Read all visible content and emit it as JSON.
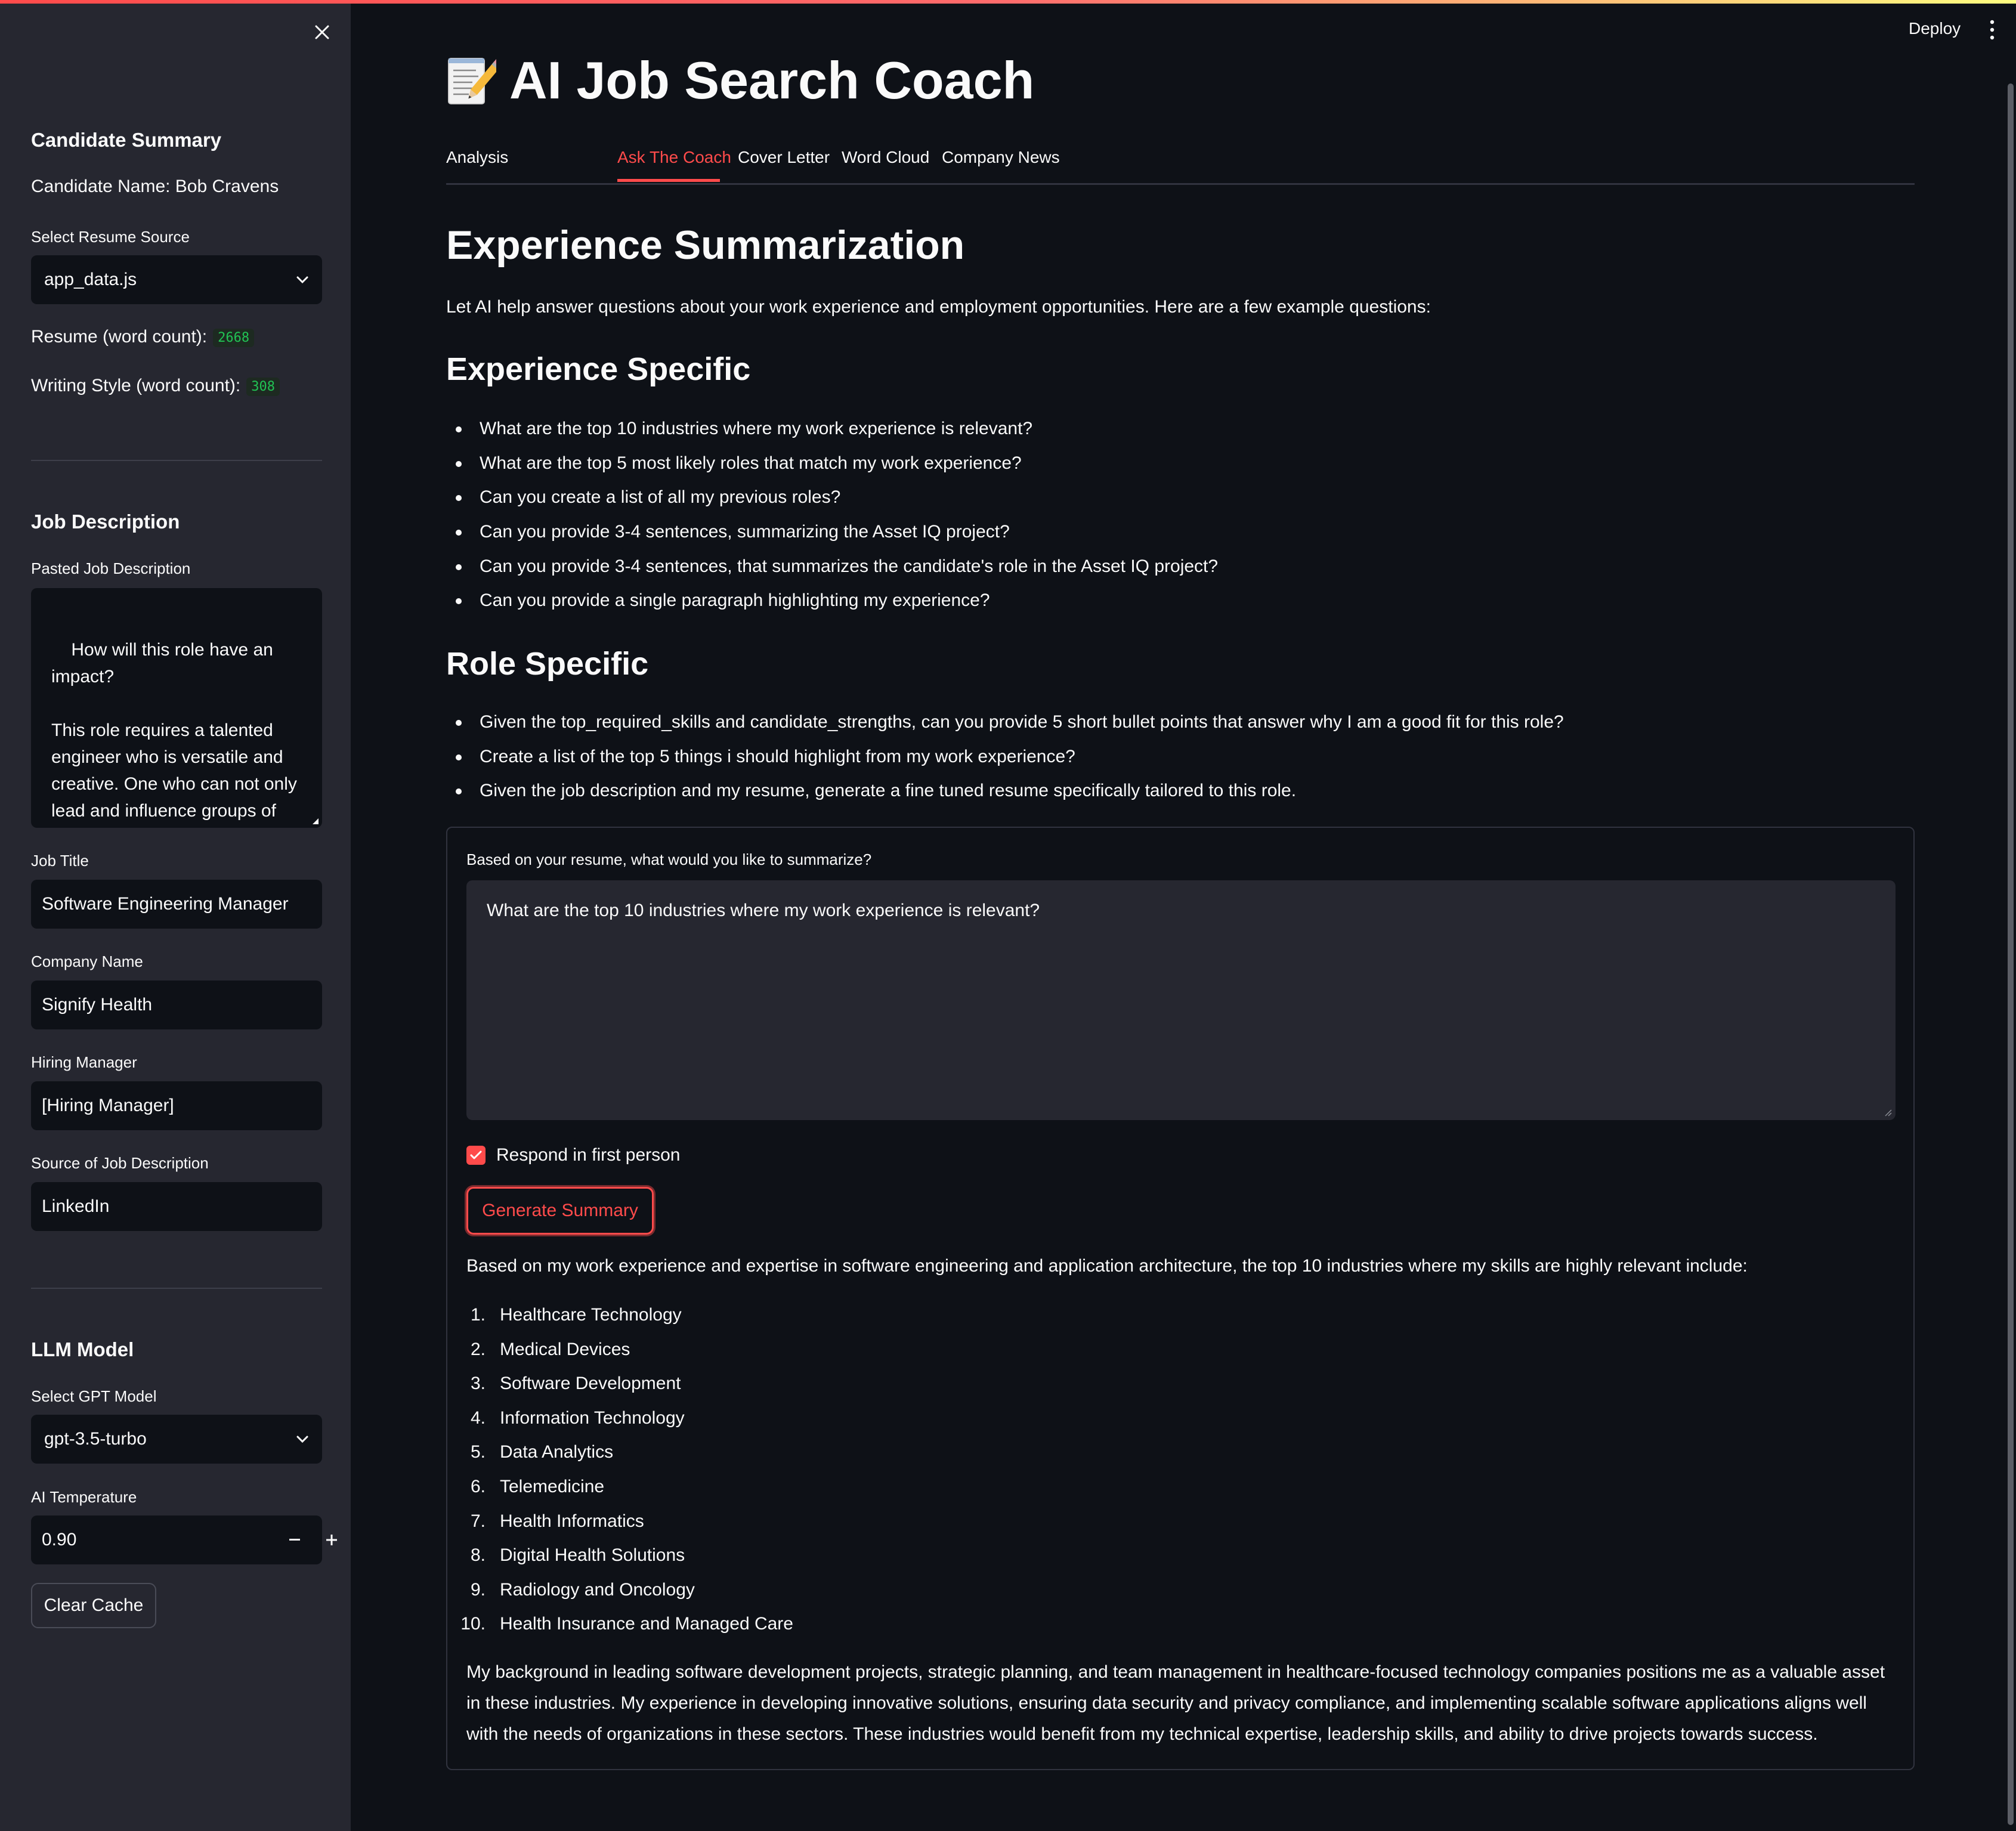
{
  "sidebar": {
    "candidate_summary_heading": "Candidate Summary",
    "candidate_name": "Candidate Name: Bob Cravens",
    "resume_source_label": "Select Resume Source",
    "resume_source_value": "app_data.js",
    "resume_word_count_label": "Resume (word count):",
    "resume_word_count": "2668",
    "writing_style_label": "Writing Style (word count):",
    "writing_style_count": "308",
    "job_description_heading": "Job Description",
    "pasted_jd_label": "Pasted Job Description",
    "pasted_jd_value": "How will this role have an impact?\n\nThis role requires a talented engineer who is versatile and creative. One who can not only lead and influence groups of teams, but be an",
    "job_title_label": "Job Title",
    "job_title_value": "Software Engineering Manager",
    "company_name_label": "Company Name",
    "company_name_value": "Signify Health",
    "hiring_manager_label": "Hiring Manager",
    "hiring_manager_value": "[Hiring Manager]",
    "jd_source_label": "Source of Job Description",
    "jd_source_value": "LinkedIn",
    "llm_heading": "LLM Model",
    "gpt_model_label": "Select GPT Model",
    "gpt_model_value": "gpt-3.5-turbo",
    "temperature_label": "AI Temperature",
    "temperature_value": "0.90",
    "clear_cache_label": "Clear Cache"
  },
  "header": {
    "deploy_label": "Deploy",
    "title": "AI Job Search Coach",
    "title_icon": "memo-icon"
  },
  "tabs": [
    {
      "label": "Analysis"
    },
    {
      "label": "Ask The Coach",
      "active": true
    },
    {
      "label": "Cover Letter"
    },
    {
      "label": "Word Cloud"
    },
    {
      "label": "Company News"
    }
  ],
  "main": {
    "heading": "Experience Summarization",
    "intro": "Let AI help answer questions about your work experience and employment opportunities. Here are a few example questions:",
    "experience_heading": "Experience Specific",
    "experience_questions": [
      "What are the top 10 industries where my work experience is relevant?",
      "What are the top 5 most likely roles that match my work experience?",
      "Can you create a list of all my previous roles?",
      "Can you provide 3-4 sentences, summarizing the Asset IQ project?",
      "Can you provide 3-4 sentences, that summarizes the candidate's role in the Asset IQ project?",
      "Can you provide a single paragraph highlighting my experience?"
    ],
    "role_heading": "Role Specific",
    "role_questions": [
      "Given the top_required_skills and candidate_strengths, can you provide 5 short bullet points that answer why I am a good fit for this role?",
      "Create a list of the top 5 things i should highlight from my work experience?",
      "Given the job description and my resume, generate a fine tuned resume specifically tailored to this role."
    ],
    "form": {
      "prompt_label": "Based on your resume, what would you like to summarize?",
      "prompt_value": "What are the top 10 industries where my work experience is relevant?",
      "first_person_label": "Respond in first person",
      "first_person_checked": true,
      "generate_label": "Generate Summary"
    },
    "result": {
      "intro": "Based on my work experience and expertise in software engineering and application architecture, the top 10 industries where my skills are highly relevant include:",
      "items": [
        {
          "num": "1.",
          "text": "Healthcare Technology"
        },
        {
          "num": "2.",
          "text": "Medical Devices"
        },
        {
          "num": "3.",
          "text": "Software Development"
        },
        {
          "num": "4.",
          "text": "Information Technology"
        },
        {
          "num": "5.",
          "text": "Data Analytics"
        },
        {
          "num": "6.",
          "text": "Telemedicine"
        },
        {
          "num": "7.",
          "text": "Health Informatics"
        },
        {
          "num": "8.",
          "text": "Digital Health Solutions"
        },
        {
          "num": "9.",
          "text": "Radiology and Oncology"
        },
        {
          "num": "10.",
          "text": "Health Insurance and Managed Care"
        }
      ],
      "conclusion": "My background in leading software development projects, strategic planning, and team management in healthcare-focused technology companies positions me as a valuable asset in these industries. My experience in developing innovative solutions, ensuring data security and privacy compliance, and implementing scalable software applications aligns well with the needs of organizations in these sectors. These industries would benefit from my technical expertise, leadership skills, and ability to drive projects towards success."
    }
  },
  "colors": {
    "accent": "#ff4b4b",
    "background": "#0e1117",
    "sidebar": "#262730",
    "badge_green": "#21c354"
  }
}
